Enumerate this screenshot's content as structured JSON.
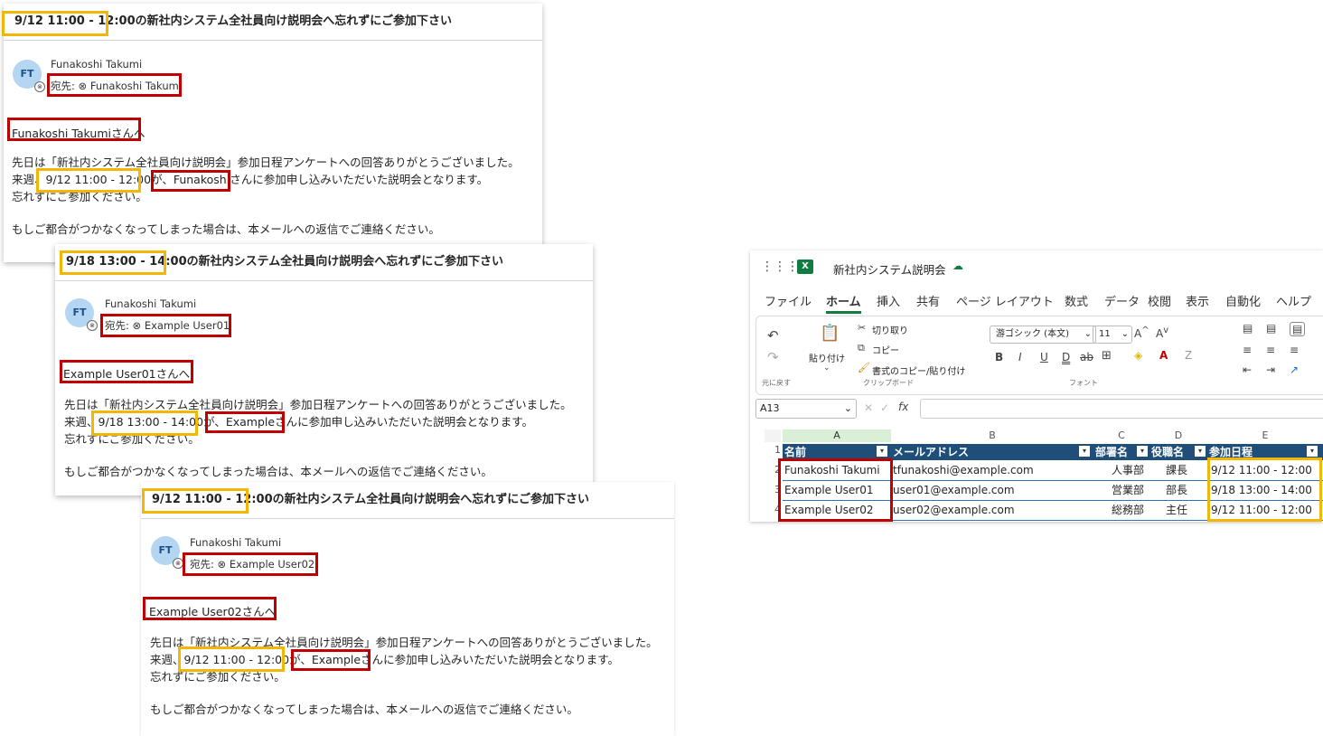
{
  "mails": [
    {
      "subject_date": "9/12 11:00 - 12:00",
      "subject_rest": "の新社内システム全社員向け説明会へ忘れずにご参加下さい",
      "avatar": "FT",
      "sender": "Funakoshi Takumi",
      "to_label": "宛先:",
      "to_name": "Funakoshi Takumi",
      "greeting": "Funakoshi Takumiさんへ",
      "line1": "先日は「新社内システム全社員向け説明会」参加日程アンケートへの回答ありがとうございました。",
      "line2_prefix": "来週、",
      "line2_date": "9/12 11:00 - 12:00",
      "line2_mid": "が、",
      "line2_name": "Funakoshiさん",
      "line2_suffix": "に参加申し込みいただいた説明会となります。",
      "line3": "忘れずにご参加ください。",
      "line4": "もしご都合がつかなくなってしまった場合は、本メールへの返信でご連絡ください。"
    },
    {
      "subject_date": "9/18 13:00 - 14:00",
      "subject_rest": "の新社内システム全社員向け説明会へ忘れずにご参加下さい",
      "avatar": "FT",
      "sender": "Funakoshi Takumi",
      "to_label": "宛先:",
      "to_name": "Example User01",
      "greeting": "Example User01さんへ",
      "line1": "先日は「新社内システム全社員向け説明会」参加日程アンケートへの回答ありがとうございました。",
      "line2_prefix": "来週、",
      "line2_date": "9/18 13:00 - 14:00",
      "line2_mid": "が、",
      "line2_name": "Exampleさん",
      "line2_suffix": "に参加申し込みいただいた説明会となります。",
      "line3": "忘れずにご参加ください。",
      "line4": "もしご都合がつかなくなってしまった場合は、本メールへの返信でご連絡ください。"
    },
    {
      "subject_date": "9/12 11:00 - 12:00",
      "subject_rest": "の新社内システム全社員向け説明会へ忘れずにご参加下さい",
      "avatar": "FT",
      "sender": "Funakoshi Takumi",
      "to_label": "宛先:",
      "to_name": "Example User02",
      "greeting": "Example User02さんへ",
      "line1": "先日は「新社内システム全社員向け説明会」参加日程アンケートへの回答ありがとうございました。",
      "line2_prefix": "来週、",
      "line2_date": "9/12 11:00 - 12:00",
      "line2_mid": "が、",
      "line2_name": "Exampleさん",
      "line2_suffix": "に参加申し込みいただいた説明会となります。",
      "line3": "忘れずにご参加ください。",
      "line4": "もしご都合がつかなくなってしまった場合は、本メールへの返信でご連絡ください。"
    }
  ],
  "excel": {
    "title": "新社内システム説明会",
    "menu": [
      "ファイル",
      "ホーム",
      "挿入",
      "共有",
      "ページ レイアウト",
      "数式",
      "データ",
      "校閲",
      "表示",
      "自動化",
      "ヘルプ"
    ],
    "active_menu": "ホーム",
    "ribbon": {
      "undo_group": "元に戻す",
      "paste": "貼り付け",
      "cut": "切り取り",
      "copy": "コピー",
      "format_painter": "書式のコピー/貼り付け",
      "clipboard_group": "クリップボード",
      "font_name": "游ゴシック (本文)",
      "font_size": "11",
      "font_group": "フォント",
      "bold": "B",
      "italic": "I",
      "underline": "U",
      "double_underline": "D",
      "strike": "ab"
    },
    "name_box": "A13",
    "fx": "fx",
    "columns": [
      "A",
      "B",
      "C",
      "D",
      "E"
    ],
    "row_numbers": [
      "1",
      "2",
      "3",
      "4"
    ],
    "headers": [
      "名前",
      "メールアドレス",
      "部署名",
      "役職名",
      "参加日程"
    ],
    "rows": [
      [
        "Funakoshi Takumi",
        "tfunakoshi@example.com",
        "人事部",
        "課長",
        "9/12 11:00 - 12:00"
      ],
      [
        "Example User01",
        "user01@example.com",
        "営業部",
        "部長",
        "9/18 13:00 - 14:00"
      ],
      [
        "Example User02",
        "user02@example.com",
        "総務部",
        "主任",
        "9/12 11:00 - 12:00"
      ]
    ],
    "colors": {
      "header_bg": "#1f4e79",
      "excel_green": "#107c41",
      "highlight_yellow": "#f2b705",
      "highlight_red": "#c00000"
    }
  }
}
